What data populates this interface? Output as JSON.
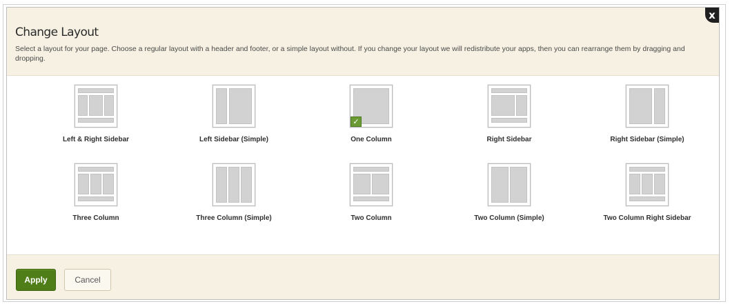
{
  "dialog": {
    "title": "Change Layout",
    "description": "Select a layout for your page. Choose a regular layout with a header and footer, or a simple layout without. If you change your layout we will redistribute your apps, then you can rearrange them by dragging and dropping.",
    "close_label": "x"
  },
  "layouts": [
    {
      "label": "Left & Right Sidebar",
      "icon": "layout-left-right-sidebar-icon",
      "selected": false
    },
    {
      "label": "Left Sidebar (Simple)",
      "icon": "layout-left-sidebar-simple-icon",
      "selected": false
    },
    {
      "label": "One Column",
      "icon": "layout-one-column-icon",
      "selected": true
    },
    {
      "label": "Right Sidebar",
      "icon": "layout-right-sidebar-icon",
      "selected": false
    },
    {
      "label": "Right Sidebar (Simple)",
      "icon": "layout-right-sidebar-simple-icon",
      "selected": false
    },
    {
      "label": "Three Column",
      "icon": "layout-three-column-icon",
      "selected": false
    },
    {
      "label": "Three Column (Simple)",
      "icon": "layout-three-column-simple-icon",
      "selected": false
    },
    {
      "label": "Two Column",
      "icon": "layout-two-column-icon",
      "selected": false
    },
    {
      "label": "Two Column (Simple)",
      "icon": "layout-two-column-simple-icon",
      "selected": false
    },
    {
      "label": "Two Column Right Sidebar",
      "icon": "layout-two-column-right-sidebar-icon",
      "selected": false
    }
  ],
  "selected_check": "✓",
  "footer": {
    "apply_label": "Apply",
    "cancel_label": "Cancel"
  },
  "colors": {
    "header_bg": "#f6f1e3",
    "apply_green": "#4f7d17",
    "check_green": "#6b9a32",
    "panel_gray": "#d2d2d2"
  }
}
